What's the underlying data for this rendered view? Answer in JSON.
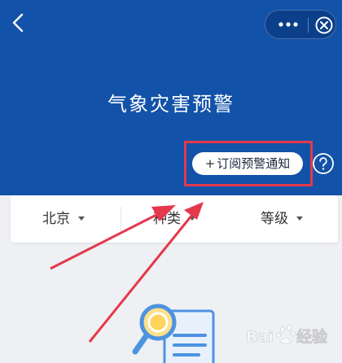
{
  "header": {
    "title": "气象灾害预警",
    "background": "#1252a8",
    "back_icon": "chevron-left-icon",
    "menu_icon": "more-dots-icon",
    "close_icon": "circle-close-icon"
  },
  "actions": {
    "subscribe_plus": "+",
    "subscribe_label": "订阅预警通知",
    "help_icon": "question-circle-icon",
    "highlight_color": "#e4394b"
  },
  "filters": [
    {
      "label": "北京"
    },
    {
      "label": "种类"
    },
    {
      "label": "等级"
    }
  ],
  "watermark": {
    "text": "Bai du 经验"
  }
}
